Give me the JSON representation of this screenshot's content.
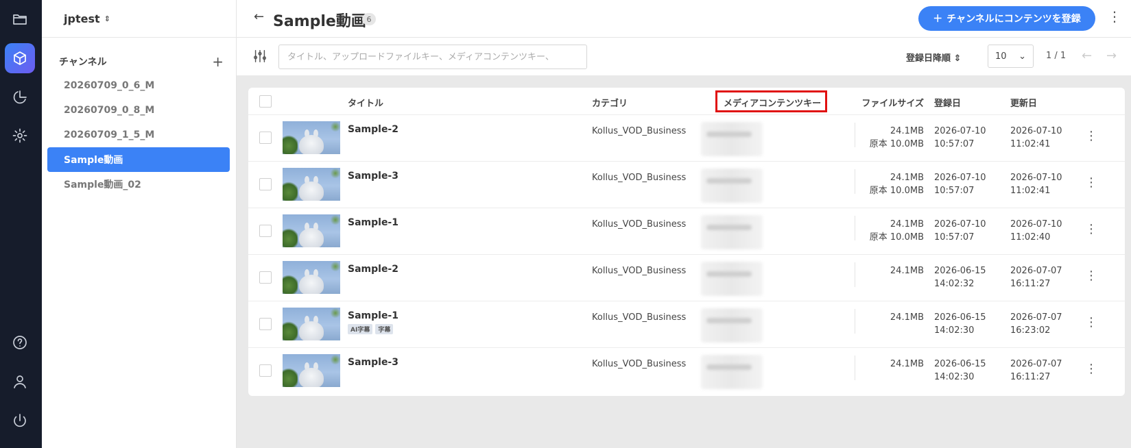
{
  "rail": {
    "items": [
      {
        "name": "folder-icon"
      },
      {
        "name": "cube-icon",
        "active": true
      },
      {
        "name": "pie-chart-icon"
      },
      {
        "name": "gear-icon"
      },
      {
        "name": "help-icon"
      },
      {
        "name": "user-icon"
      },
      {
        "name": "power-icon"
      }
    ]
  },
  "sidebar": {
    "workspace": "jptest",
    "channels_label": "チャンネル",
    "items": [
      {
        "label": "20260709_0_6_M"
      },
      {
        "label": "20260709_0_8_M"
      },
      {
        "label": "20260709_1_5_M"
      },
      {
        "label": "Sample動画",
        "active": true
      },
      {
        "label": "Sample動画_02"
      }
    ]
  },
  "header": {
    "title": "Sample動画",
    "count": "6",
    "register_label": "チャンネルにコンテンツを登録"
  },
  "toolbar": {
    "search_placeholder": "タイトル、アップロードファイルキー、メディアコンテンツキー、ᅠ",
    "sort_label": "登録日降順",
    "per_page": "10",
    "pagination": "1 / 1"
  },
  "table": {
    "columns": {
      "title": "タイトル",
      "category": "カテゴリ",
      "media_key": "メディアコンテンツキー",
      "file_size": "ファイルサイズ",
      "registered": "登録日",
      "updated": "更新日"
    },
    "rows": [
      {
        "title": "Sample-2",
        "category": "Kollus_VOD_Business",
        "size": "24.1MB",
        "orig": "原本 10.0MB",
        "reg_date": "2026-07-10",
        "reg_time": "10:57:07",
        "upd_date": "2026-07-10",
        "upd_time": "11:02:41",
        "tags": []
      },
      {
        "title": "Sample-3",
        "category": "Kollus_VOD_Business",
        "size": "24.1MB",
        "orig": "原本 10.0MB",
        "reg_date": "2026-07-10",
        "reg_time": "10:57:07",
        "upd_date": "2026-07-10",
        "upd_time": "11:02:41",
        "tags": []
      },
      {
        "title": "Sample-1",
        "category": "Kollus_VOD_Business",
        "size": "24.1MB",
        "orig": "原本 10.0MB",
        "reg_date": "2026-07-10",
        "reg_time": "10:57:07",
        "upd_date": "2026-07-10",
        "upd_time": "11:02:40",
        "tags": []
      },
      {
        "title": "Sample-2",
        "category": "Kollus_VOD_Business",
        "size": "24.1MB",
        "orig": "",
        "reg_date": "2026-06-15",
        "reg_time": "14:02:32",
        "upd_date": "2026-07-07",
        "upd_time": "16:11:27",
        "tags": []
      },
      {
        "title": "Sample-1",
        "category": "Kollus_VOD_Business",
        "size": "24.1MB",
        "orig": "",
        "reg_date": "2026-06-15",
        "reg_time": "14:02:30",
        "upd_date": "2026-07-07",
        "upd_time": "16:23:02",
        "tags": [
          "AI字幕",
          "字幕"
        ]
      },
      {
        "title": "Sample-3",
        "category": "Kollus_VOD_Business",
        "size": "24.1MB",
        "orig": "",
        "reg_date": "2026-06-15",
        "reg_time": "14:02:30",
        "upd_date": "2026-07-07",
        "upd_time": "16:11:27",
        "tags": []
      }
    ]
  },
  "colors": {
    "accent": "#3b82f6",
    "rail_bg": "#161c2b",
    "highlight": "#e01010"
  }
}
